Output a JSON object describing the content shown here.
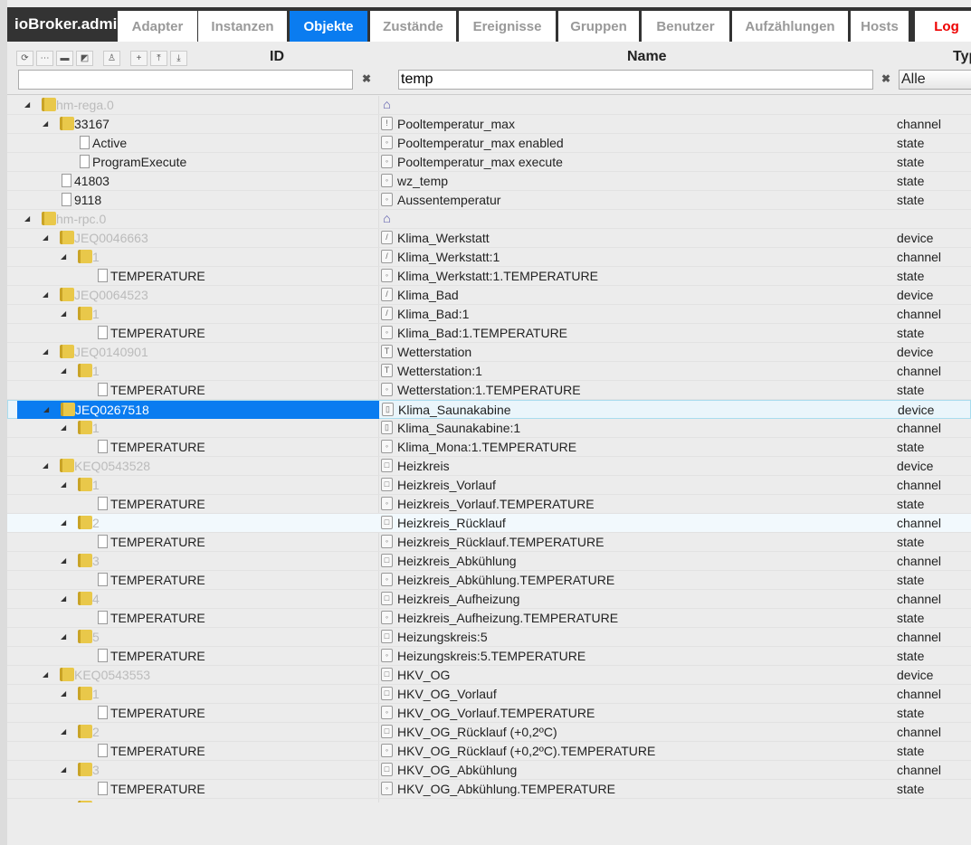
{
  "app_title": "ioBroker.admin",
  "tabs": [
    {
      "label": "Adapter"
    },
    {
      "label": "Instanzen"
    },
    {
      "label": "Objekte",
      "active": true
    },
    {
      "label": "Zustände"
    },
    {
      "label": "Ereignisse"
    },
    {
      "label": "Gruppen"
    },
    {
      "label": "Benutzer"
    },
    {
      "label": "Aufzählungen"
    },
    {
      "label": "Hosts"
    },
    {
      "label": "Log",
      "color": "#e00000"
    }
  ],
  "accent": "#0a7cf0",
  "toolbar_icons": [
    "refresh-icon",
    "list-icon",
    "folder-closed-icon",
    "folder-open-icon",
    "user-icon",
    "add-icon",
    "upload-icon",
    "download-icon"
  ],
  "columns": {
    "id": "ID",
    "name": "Name",
    "type": "Typ"
  },
  "filters": {
    "id": "",
    "name": "temp",
    "type": "Alle"
  },
  "rows": [
    {
      "level": 0,
      "id": "hm-rega.0",
      "kind": "folder",
      "grey": true,
      "icon": "building",
      "name": "",
      "type": ""
    },
    {
      "level": 1,
      "id": "33167",
      "kind": "folder",
      "icon": "channel",
      "name": "Pooltemperatur_max",
      "type": "channel"
    },
    {
      "level": 2,
      "id": "Active",
      "kind": "file",
      "icon": "state",
      "name": "Pooltemperatur_max enabled",
      "type": "state"
    },
    {
      "level": 2,
      "id": "ProgramExecute",
      "kind": "file",
      "icon": "state",
      "name": "Pooltemperatur_max execute",
      "type": "state"
    },
    {
      "level": 1,
      "id": "41803",
      "kind": "file",
      "icon": "state",
      "name": "wz_temp",
      "type": "state"
    },
    {
      "level": 1,
      "id": "9118",
      "kind": "file",
      "icon": "state",
      "name": "Aussentemperatur",
      "type": "state"
    },
    {
      "level": 0,
      "id": "hm-rpc.0",
      "kind": "folder",
      "grey": true,
      "icon": "building",
      "name": "",
      "type": ""
    },
    {
      "level": 1,
      "id": "JEQ0046663",
      "kind": "folder",
      "grey": true,
      "icon": "thermostat",
      "name": "Klima_Werkstatt",
      "type": "device"
    },
    {
      "level": 2,
      "id": "1",
      "kind": "folder",
      "grey": true,
      "icon": "thermostat",
      "name": "Klima_Werkstatt:1",
      "type": "channel"
    },
    {
      "level": 3,
      "id": "TEMPERATURE",
      "kind": "file",
      "icon": "state",
      "name": "Klima_Werkstatt:1.TEMPERATURE",
      "type": "state"
    },
    {
      "level": 1,
      "id": "JEQ0064523",
      "kind": "folder",
      "grey": true,
      "icon": "thermostat",
      "name": "Klima_Bad",
      "type": "device"
    },
    {
      "level": 2,
      "id": "1",
      "kind": "folder",
      "grey": true,
      "icon": "thermostat",
      "name": "Klima_Bad:1",
      "type": "channel"
    },
    {
      "level": 3,
      "id": "TEMPERATURE",
      "kind": "file",
      "icon": "state",
      "name": "Klima_Bad:1.TEMPERATURE",
      "type": "state"
    },
    {
      "level": 1,
      "id": "JEQ0140901",
      "kind": "folder",
      "grey": true,
      "icon": "weather",
      "name": "Wetterstation",
      "type": "device"
    },
    {
      "level": 2,
      "id": "1",
      "kind": "folder",
      "grey": true,
      "icon": "weather",
      "name": "Wetterstation:1",
      "type": "channel"
    },
    {
      "level": 3,
      "id": "TEMPERATURE",
      "kind": "file",
      "icon": "state",
      "name": "Wetterstation:1.TEMPERATURE",
      "type": "state"
    },
    {
      "level": 1,
      "id": "JEQ0267518",
      "kind": "folder",
      "grey": true,
      "selected": true,
      "icon": "sensor",
      "name": "Klima_Saunakabine",
      "type": "device"
    },
    {
      "level": 2,
      "id": "1",
      "kind": "folder",
      "grey": true,
      "icon": "sensor",
      "name": "Klima_Saunakabine:1",
      "type": "channel"
    },
    {
      "level": 3,
      "id": "TEMPERATURE",
      "kind": "file",
      "icon": "state",
      "name": "Klima_Mona:1.TEMPERATURE",
      "type": "state"
    },
    {
      "level": 1,
      "id": "KEQ0543528",
      "kind": "folder",
      "grey": true,
      "icon": "valve",
      "name": "Heizkreis",
      "type": "device"
    },
    {
      "level": 2,
      "id": "1",
      "kind": "folder",
      "grey": true,
      "icon": "valve",
      "name": "Heizkreis_Vorlauf",
      "type": "channel"
    },
    {
      "level": 3,
      "id": "TEMPERATURE",
      "kind": "file",
      "icon": "state",
      "name": "Heizkreis_Vorlauf.TEMPERATURE",
      "type": "state"
    },
    {
      "level": 2,
      "id": "2",
      "kind": "folder",
      "grey": true,
      "hover": true,
      "icon": "valve",
      "name": "Heizkreis_Rücklauf",
      "type": "channel"
    },
    {
      "level": 3,
      "id": "TEMPERATURE",
      "kind": "file",
      "icon": "state",
      "name": "Heizkreis_Rücklauf.TEMPERATURE",
      "type": "state"
    },
    {
      "level": 2,
      "id": "3",
      "kind": "folder",
      "grey": true,
      "icon": "valve",
      "name": "Heizkreis_Abkühlung",
      "type": "channel"
    },
    {
      "level": 3,
      "id": "TEMPERATURE",
      "kind": "file",
      "icon": "state",
      "name": "Heizkreis_Abkühlung.TEMPERATURE",
      "type": "state"
    },
    {
      "level": 2,
      "id": "4",
      "kind": "folder",
      "grey": true,
      "icon": "valve",
      "name": "Heizkreis_Aufheizung",
      "type": "channel"
    },
    {
      "level": 3,
      "id": "TEMPERATURE",
      "kind": "file",
      "icon": "state",
      "name": "Heizkreis_Aufheizung.TEMPERATURE",
      "type": "state"
    },
    {
      "level": 2,
      "id": "5",
      "kind": "folder",
      "grey": true,
      "icon": "valve",
      "name": "Heizungskreis:5",
      "type": "channel"
    },
    {
      "level": 3,
      "id": "TEMPERATURE",
      "kind": "file",
      "icon": "state",
      "name": "Heizungskreis:5.TEMPERATURE",
      "type": "state"
    },
    {
      "level": 1,
      "id": "KEQ0543553",
      "kind": "folder",
      "grey": true,
      "icon": "valve",
      "name": "HKV_OG",
      "type": "device"
    },
    {
      "level": 2,
      "id": "1",
      "kind": "folder",
      "grey": true,
      "icon": "valve",
      "name": "HKV_OG_Vorlauf",
      "type": "channel"
    },
    {
      "level": 3,
      "id": "TEMPERATURE",
      "kind": "file",
      "icon": "state",
      "name": "HKV_OG_Vorlauf.TEMPERATURE",
      "type": "state"
    },
    {
      "level": 2,
      "id": "2",
      "kind": "folder",
      "grey": true,
      "icon": "valve",
      "name": "HKV_OG_Rücklauf (+0,2ºC)",
      "type": "channel"
    },
    {
      "level": 3,
      "id": "TEMPERATURE",
      "kind": "file",
      "icon": "state",
      "name": "HKV_OG_Rücklauf (+0,2ºC).TEMPERATURE",
      "type": "state"
    },
    {
      "level": 2,
      "id": "3",
      "kind": "folder",
      "grey": true,
      "icon": "valve",
      "name": "HKV_OG_Abkühlung",
      "type": "channel"
    },
    {
      "level": 3,
      "id": "TEMPERATURE",
      "kind": "file",
      "icon": "state",
      "name": "HKV_OG_Abkühlung.TEMPERATURE",
      "type": "state"
    }
  ]
}
